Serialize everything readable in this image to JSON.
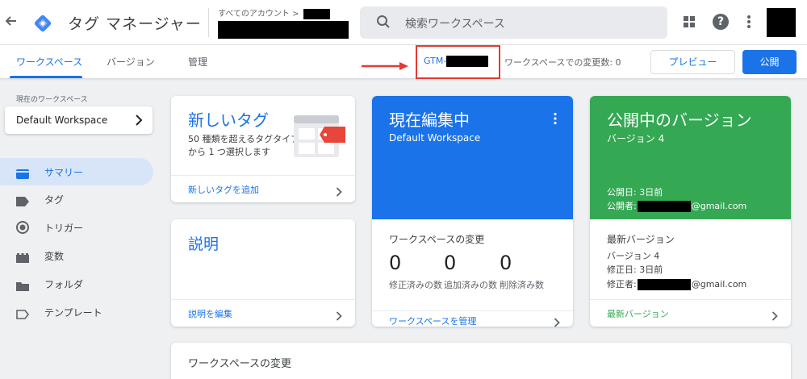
{
  "header": {
    "app_title": "タグ マネージャー",
    "account_crumb": "すべてのアカウント >",
    "search_placeholder": "検索ワークスペース",
    "help_glyph": "?"
  },
  "subnav": {
    "tabs": [
      {
        "label": "ワークスペース",
        "active": true
      },
      {
        "label": "バージョン",
        "active": false
      },
      {
        "label": "管理",
        "active": false
      }
    ],
    "container_id_prefix": "GTM-",
    "workspace_changes": "ワークスペースでの変更数: 0",
    "preview_label": "プレビュー",
    "publish_label": "公開"
  },
  "sidebar": {
    "current_workspace_label": "現在のワークスペース",
    "workspace_name": "Default Workspace",
    "items": [
      {
        "label": "サマリー",
        "icon": "summary-icon",
        "active": true
      },
      {
        "label": "タグ",
        "icon": "tag-icon",
        "active": false
      },
      {
        "label": "トリガー",
        "icon": "trigger-icon",
        "active": false
      },
      {
        "label": "変数",
        "icon": "variable-icon",
        "active": false
      },
      {
        "label": "フォルダ",
        "icon": "folder-icon",
        "active": false
      },
      {
        "label": "テンプレート",
        "icon": "template-icon",
        "active": false
      }
    ]
  },
  "cards": {
    "new_tag": {
      "title": "新しいタグ",
      "description": "50 種類を超えるタグタイプから 1 つ選択します",
      "link": "新しいタグを追加"
    },
    "description": {
      "title": "説明",
      "link": "説明を編集"
    },
    "editing": {
      "title": "現在編集中",
      "workspace": "Default Workspace",
      "changes_title": "ワークスペースの変更",
      "stats": [
        {
          "value": "0",
          "label": "修正済みの数"
        },
        {
          "value": "0",
          "label": "追加済みの数"
        },
        {
          "value": "0",
          "label": "削除済み数"
        }
      ],
      "link": "ワークスペースを管理"
    },
    "published": {
      "title": "公開中のバージョン",
      "version": "バージョン 4",
      "published_date": "公開日: 3日前",
      "published_by_prefix": "公開者:",
      "published_by_suffix": "@gmail.com",
      "latest_title": "最新バージョン",
      "latest_version": "バージョン 4",
      "modified_date": "修正日: 3日前",
      "modified_by_prefix": "修正者:",
      "modified_by_suffix": "@gmail.com",
      "link": "最新バージョン"
    },
    "workspace_changes": {
      "title": "ワークスペースの変更"
    }
  },
  "colors": {
    "primary": "#1a73e8",
    "green": "#34a853",
    "annotation_red": "#e53935"
  }
}
